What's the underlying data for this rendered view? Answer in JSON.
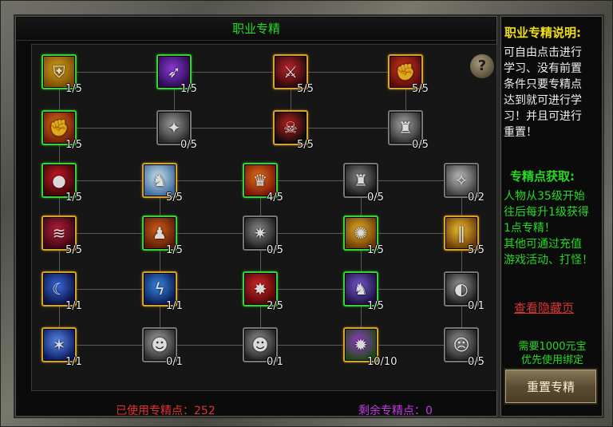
{
  "title": "职业专精",
  "help_icon": "question-mark-icon",
  "rows": [
    [
      {
        "count": "1/5",
        "state": "green",
        "colors": [
          "#d4a21a",
          "#7a4a05"
        ],
        "icon": "shield-icon"
      },
      {
        "count": "1/5",
        "state": "green",
        "colors": [
          "#8a3bd6",
          "#2a0a50"
        ],
        "icon": "spear-strike-icon"
      },
      {
        "count": "5/5",
        "state": "gold",
        "colors": [
          "#c02530",
          "#2a0808"
        ],
        "icon": "twin-blades-icon"
      },
      {
        "count": "5/5",
        "state": "gold",
        "colors": [
          "#d83a1a",
          "#5a0a0a"
        ],
        "icon": "beast-fist-icon"
      }
    ],
    [
      {
        "count": "1/5",
        "state": "green",
        "colors": [
          "#e3741b",
          "#6a1a05"
        ],
        "icon": "fire-fist-icon"
      },
      {
        "count": "0/5",
        "state": "gray",
        "colors": [
          "#9a9a9a",
          "#2a2a2a"
        ],
        "icon": "armor-icon"
      },
      {
        "count": "5/5",
        "state": "gold",
        "colors": [
          "#c02020",
          "#0a0a0a"
        ],
        "icon": "demon-skull-icon"
      },
      {
        "count": "0/5",
        "state": "gray",
        "colors": [
          "#aaaaaa",
          "#2a2a2a"
        ],
        "icon": "warrior-icon"
      }
    ],
    [
      {
        "count": "1/5",
        "state": "green",
        "colors": [
          "#d01a28",
          "#3a0505"
        ],
        "icon": "blood-berries-icon"
      },
      {
        "count": "5/5",
        "state": "gold",
        "colors": [
          "#cfe4f0",
          "#3a6a9a"
        ],
        "icon": "ice-warrior-icon"
      },
      {
        "count": "4/5",
        "state": "green",
        "colors": [
          "#e3741b",
          "#7a1205"
        ],
        "icon": "flame-helm-icon"
      },
      {
        "count": "0/5",
        "state": "gray",
        "colors": [
          "#8a8a8a",
          "#151515"
        ],
        "icon": "dark-armor-icon"
      },
      {
        "count": "0/2",
        "state": "gray",
        "colors": [
          "#bdbdbd",
          "#3a3a3a"
        ],
        "icon": "spirit-icon"
      }
    ],
    [
      {
        "count": "5/5",
        "state": "gold",
        "colors": [
          "#b8203a",
          "#3a0512"
        ],
        "icon": "claw-icon"
      },
      {
        "count": "1/5",
        "state": "green",
        "colors": [
          "#d0601a",
          "#5a1a05"
        ],
        "icon": "brute-icon"
      },
      {
        "count": "0/5",
        "state": "gray",
        "colors": [
          "#8a8a8a",
          "#1a1a1a"
        ],
        "icon": "spiked-armor-icon"
      },
      {
        "count": "1/5",
        "state": "green",
        "colors": [
          "#e6b02a",
          "#6a3805"
        ],
        "icon": "burst-icon"
      },
      {
        "count": "5/5",
        "state": "gold",
        "colors": [
          "#f0c030",
          "#6a3a05"
        ],
        "icon": "golden-pillar-icon"
      }
    ],
    [
      {
        "count": "1/1",
        "state": "gold",
        "colors": [
          "#3a6ae0",
          "#0a1240"
        ],
        "icon": "crescent-moon-icon"
      },
      {
        "count": "1/1",
        "state": "gold",
        "colors": [
          "#3a8ae8",
          "#0a1a50"
        ],
        "icon": "lightning-icon"
      },
      {
        "count": "2/5",
        "state": "green",
        "colors": [
          "#d82a2a",
          "#4a0505"
        ],
        "icon": "red-star-icon"
      },
      {
        "count": "1/5",
        "state": "green",
        "colors": [
          "#7a5ad0",
          "#1a1040"
        ],
        "icon": "knight-helm-icon"
      },
      {
        "count": "0/1",
        "state": "gray",
        "colors": [
          "#9a9a9a",
          "#1a1a1a"
        ],
        "icon": "crescent-blade-icon"
      }
    ],
    [
      {
        "count": "1/1",
        "state": "gold",
        "colors": [
          "#5a8ae8",
          "#0a1a60"
        ],
        "icon": "ice-shards-icon"
      },
      {
        "count": "0/1",
        "state": "gray",
        "colors": [
          "#aaaaaa",
          "#2a2a2a"
        ],
        "icon": "stone-face-icon"
      },
      {
        "count": "0/1",
        "state": "gray",
        "colors": [
          "#9a9a9a",
          "#1f1f1f"
        ],
        "icon": "orc-icon"
      },
      {
        "count": "10/10",
        "state": "gold",
        "colors": [
          "#9a3ad0",
          "#1a4a10"
        ],
        "icon": "purple-flame-icon"
      },
      {
        "count": "0/5",
        "state": "gray",
        "colors": [
          "#9a9a9a",
          "#1f1f1f"
        ],
        "icon": "roaring-beast-icon"
      }
    ]
  ],
  "footer": {
    "used_label": "已使用专精点：252",
    "remaining_label": "剩余专精点：0"
  },
  "side": {
    "desc_title": "职业专精说明:",
    "desc_lines": [
      "可自由点击进行",
      "学习、没有前置",
      "条件只要专精点",
      "达到就可进行学",
      "习！并且可进行",
      "重置！"
    ],
    "gain_title": "专精点获取:",
    "gain_lines": [
      "人物从35级开始",
      "往后每升1级获得",
      "1点专精！",
      "其他可通过充值",
      "游戏活动、打怪！"
    ],
    "hidden_link": "查看隐藏页",
    "notice_lines": [
      "需要1000元宝",
      "优先使用绑定"
    ],
    "reset_label": "重置专精"
  }
}
